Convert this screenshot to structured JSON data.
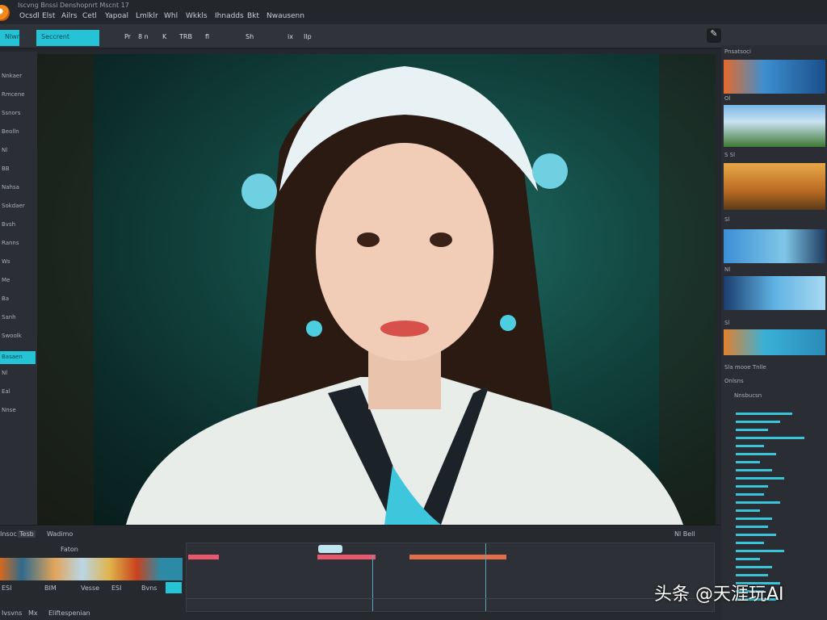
{
  "app": {
    "title": "Iscvng Bnssi Denshopnrt Mscnt 17"
  },
  "menu": [
    "Ocsdl",
    "Elst",
    "Ailrs",
    "Cetl",
    "Yapoal",
    "Lmlklr",
    "Whl",
    "Wkkls",
    "Ihnadds",
    "Bkt",
    "Nwausenn"
  ],
  "toolbar": {
    "left_button": "Nlwnd",
    "search_button": "Seccrent",
    "tools": [
      "Pr",
      "8 n",
      "K",
      "TRB",
      "fl",
      "Sh",
      "ix",
      "Ilp"
    ]
  },
  "left_panel": {
    "items": [
      "Nnkaer",
      "Rmcene",
      "Ssnors",
      "Beolln",
      "Nl",
      "BB",
      "Nahsa",
      "Sokdaer",
      "Bvsh",
      "Ranns",
      "Ws",
      "Me",
      "Ba",
      "Sanh",
      "Swoolk",
      "Basaen",
      "Nl",
      "Eal",
      "Nnse"
    ],
    "selected_index": 15
  },
  "right_panel": {
    "header": "Pnsatsoci",
    "sections": [
      "Ol",
      "S Sl",
      "Sl",
      "Nl",
      "Sl"
    ],
    "media_header": "Sla mooe Tnlle",
    "list_header": "Onlsns",
    "list_item": "Nnsbucsn"
  },
  "bottom": {
    "tabs": [
      "Insoc",
      "Tesb"
    ],
    "panel_label": "Wadimo",
    "sub_label": "Faton",
    "row_labels": [
      "ESI",
      "BIM",
      "Vesse",
      "ESI",
      "Bvns"
    ],
    "footer": [
      "Ivsvns",
      "Mx",
      "Eliftespenian"
    ],
    "right_tools": [
      "Nl Bell"
    ]
  },
  "watermark": "头条 @天涯玩AI",
  "colors": {
    "accent": "#25c3d6",
    "clip_red": "#e8576b",
    "clip_orange": "#e0704a"
  }
}
